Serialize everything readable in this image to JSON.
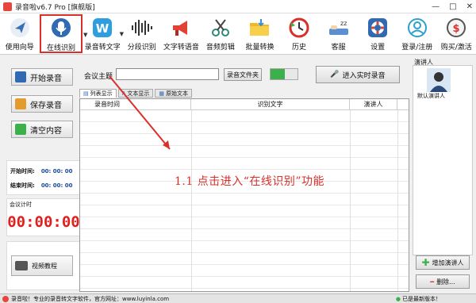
{
  "window": {
    "title": "录音啦v6.7 Pro [旗舰版]",
    "controls": [
      "—",
      "□",
      "✕"
    ]
  },
  "toolbar": {
    "items": [
      {
        "label": "使用向导",
        "icon": "guide-icon"
      },
      {
        "label": "在线识别",
        "icon": "microphone-icon",
        "selected": true
      },
      {
        "label": "录音转文字",
        "icon": "w-badge-icon"
      },
      {
        "label": "分段识别",
        "icon": "waveform-icon"
      },
      {
        "label": "文字转语音",
        "icon": "megaphone-icon"
      },
      {
        "label": "音频剪辑",
        "icon": "scissors-icon"
      },
      {
        "label": "批量转换",
        "icon": "folder-icon"
      },
      {
        "label": "历史",
        "icon": "history-icon"
      },
      {
        "label": "客服",
        "icon": "sleep-icon"
      },
      {
        "label": "设置",
        "icon": "lifebuoy-icon"
      },
      {
        "label": "登录/注册",
        "icon": "user-icon"
      },
      {
        "label": "购买/激活",
        "icon": "dollar-icon"
      }
    ]
  },
  "left": {
    "start_label": "开始录音",
    "save_label": "保存录音",
    "clear_label": "清空内容",
    "start_time_label": "开始时间:",
    "start_time_value": "00: 00: 00",
    "end_time_label": "结束时间:",
    "end_time_value": "00: 00: 00",
    "meeting_time_label": "会议计时",
    "timer": "00:00:00",
    "tutorial_label": "视频教程"
  },
  "meeting": {
    "topic_label": "会议主题",
    "topic_value": "",
    "folder_button": "录音文件夹",
    "realtime_button": "进入实时录音"
  },
  "tabs": [
    {
      "label": "列表显示",
      "active": true
    },
    {
      "label": "文本显示",
      "active": false
    },
    {
      "label": "原始文本",
      "active": false
    }
  ],
  "table": {
    "columns": [
      "录音时间",
      "识别文字",
      "演讲人"
    ]
  },
  "speakers": {
    "header": "演讲人",
    "default_label": "默认演讲人",
    "add_button": "增加演讲人",
    "remove_button": "删除..."
  },
  "status": {
    "text": "录音啦！专业的录音转文字软件，官方网址：www.luyinla.com",
    "version_note": "已是最新版本！"
  },
  "annotation": "1.1  点击进入“在线识别”功能",
  "colors": {
    "accent": "#d9302b",
    "timer": "#e0201c",
    "highlight_border": "#d9302b",
    "toggle_green": "#3cb04a"
  }
}
